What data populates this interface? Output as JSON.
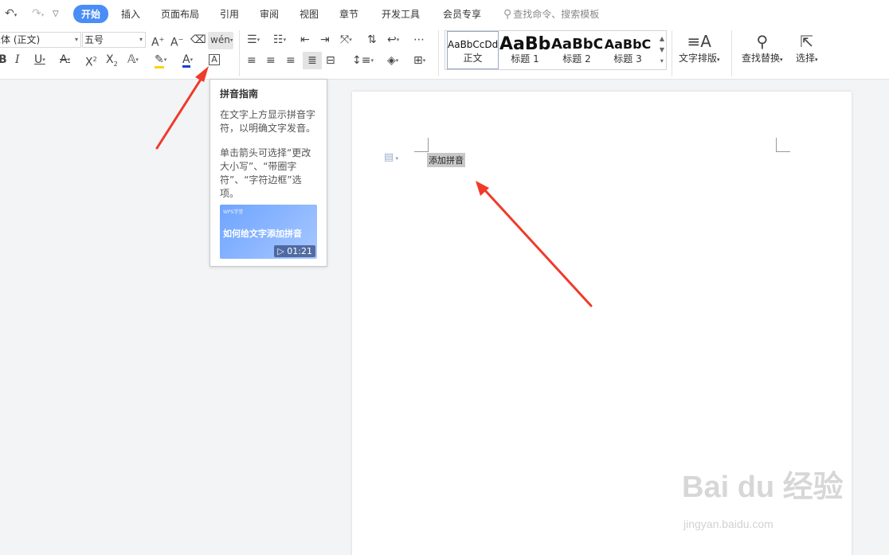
{
  "menubar": {
    "tabs": [
      "开始",
      "插入",
      "页面布局",
      "引用",
      "审阅",
      "视图",
      "章节",
      "开发工具",
      "会员专享"
    ],
    "active_tab": "开始",
    "search_placeholder": "查找命令、搜索模板"
  },
  "ribbon": {
    "font_name": "宋体 (正文)",
    "font_size": "五号",
    "styles": [
      {
        "sample": "AaBbCcDd",
        "name": "正文"
      },
      {
        "sample": "AaBb",
        "name": "标题 1"
      },
      {
        "sample": "AaBbC",
        "name": "标题 2"
      },
      {
        "sample": "AaBbC",
        "name": "标题 3"
      }
    ],
    "text_layout_label": "文字排版",
    "find_replace_label": "查找替换",
    "select_label": "选择"
  },
  "tooltip": {
    "title": "拼音指南",
    "desc1": "在文字上方显示拼音字符，以明确文字发音。",
    "desc2": "单击箭头可选择“更改大小写”、“带圈字符”、“字符边框”选项。",
    "video_brand": "WPS学堂",
    "video_title": "如何给文字添加拼音",
    "video_duration": "01:21"
  },
  "document": {
    "selected_text": "添加拼音"
  },
  "watermark": {
    "text": "Bai du 经验",
    "sub": "jingyan.baidu.com"
  },
  "colors": {
    "accent": "#4a8df6",
    "arrow": "#f03a2a",
    "highlight_bar": "#ffd200",
    "font_color_bar": "#1a40d0"
  }
}
